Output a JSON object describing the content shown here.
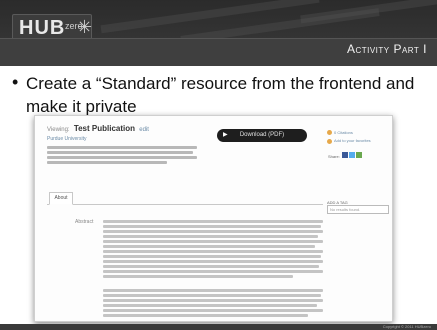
{
  "header": {
    "logo_text": "HUB",
    "logo_zero": "zero",
    "slide_title": "Activity Part I"
  },
  "content": {
    "bullet": "Create a “Standard” resource from the frontend and make it private"
  },
  "screenshot": {
    "title_prefix": "Viewing:",
    "title": "Test Publication",
    "edit_link": "edit",
    "subtitle": "Purdue University",
    "download_label": "Download (PDF)",
    "side_links": [
      "0 Citations",
      "Add to your favorites"
    ],
    "share_label": "Share:",
    "tab_label": "About",
    "tag_label": "ADD A TAG",
    "tag_placeholder": "No results found.",
    "abstract_label": "Abstract"
  },
  "footer": {
    "copyright": "Copyright © 2011 HUBzero"
  },
  "colors": {
    "header_bg": "#3a3a3a",
    "accent_link": "#6a8aa6",
    "download_bg": "#1e1e1e"
  }
}
